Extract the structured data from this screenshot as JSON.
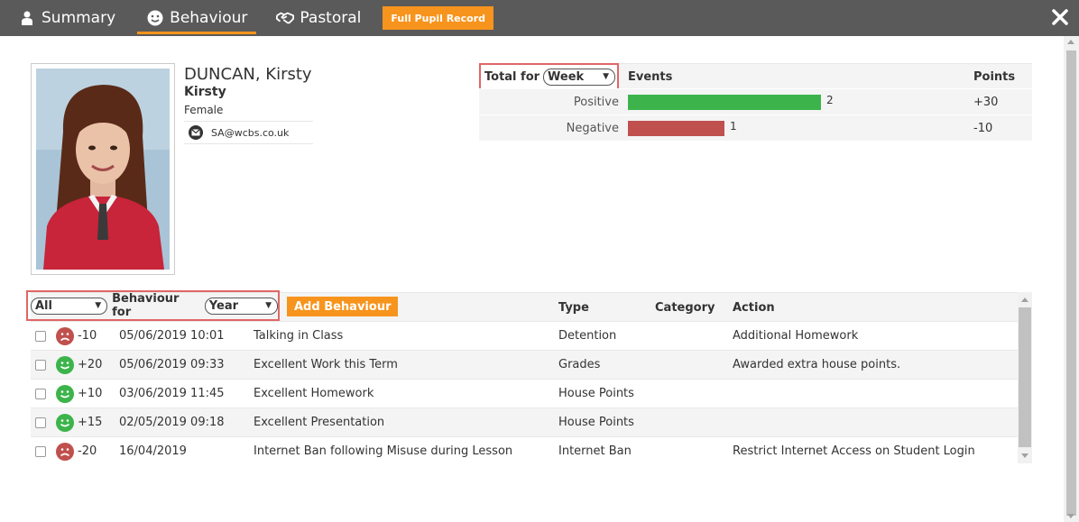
{
  "tabs": [
    {
      "label": "Summary",
      "icon": "person-icon"
    },
    {
      "label": "Behaviour",
      "icon": "smiley-icon",
      "active": true
    },
    {
      "label": "Pastoral",
      "icon": "handshake-icon"
    }
  ],
  "full_record_label": "Full Pupil Record",
  "pupil": {
    "full_name": "DUNCAN, Kirsty",
    "first_name": "Kirsty",
    "gender": "Female",
    "email": "SA@wcbs.co.uk"
  },
  "summary": {
    "total_for_label": "Total for",
    "period_select": "Week",
    "col_events": "Events",
    "col_points": "Points",
    "rows": [
      {
        "label": "Positive",
        "events": 2,
        "events_text": "2",
        "points": "+30",
        "color": "#3cb44b"
      },
      {
        "label": "Negative",
        "events": 1,
        "events_text": "1",
        "points": "-10",
        "color": "#c0504d"
      }
    ]
  },
  "list": {
    "filter_select": "All",
    "behaviour_for_label": "Behaviour for",
    "period_select": "Year",
    "add_label": "Add Behaviour",
    "headers": {
      "type": "Type",
      "category": "Category",
      "action": "Action"
    },
    "rows": [
      {
        "sentiment": "negative",
        "points": "-10",
        "date": "05/06/2019 10:01",
        "description": "Talking in Class",
        "type": "Detention",
        "category": "",
        "action": "Additional Homework"
      },
      {
        "sentiment": "positive",
        "points": "+20",
        "date": "05/06/2019 09:33",
        "description": "Excellent Work this Term",
        "type": "Grades",
        "category": "",
        "action": "Awarded extra house points."
      },
      {
        "sentiment": "positive",
        "points": "+10",
        "date": "03/06/2019 11:45",
        "description": "Excellent Homework",
        "type": "House Points",
        "category": "",
        "action": ""
      },
      {
        "sentiment": "positive",
        "points": "+15",
        "date": "02/05/2019 09:18",
        "description": "Excellent Presentation",
        "type": "House Points",
        "category": "",
        "action": ""
      },
      {
        "sentiment": "negative",
        "points": "-20",
        "date": "16/04/2019",
        "description": "Internet Ban following Misuse during Lesson",
        "type": "Internet Ban",
        "category": "",
        "action": "Restrict Internet Access on Student Login"
      }
    ]
  },
  "colors": {
    "accent": "#f7941d",
    "topbar": "#5a5a5a",
    "positive": "#3cb44b",
    "negative": "#c0504d",
    "highlight_border": "#e06666"
  }
}
